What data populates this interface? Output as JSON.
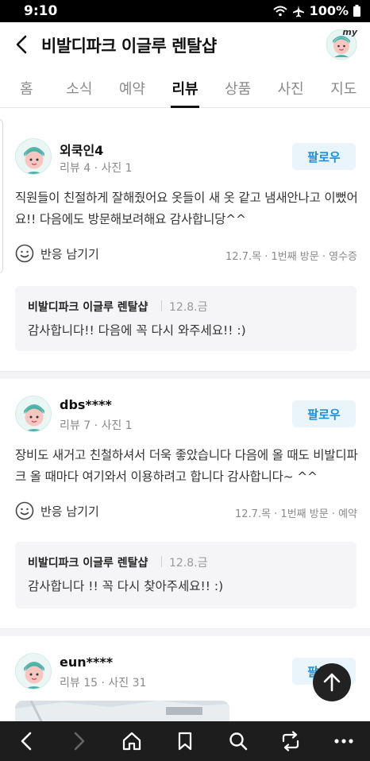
{
  "status": {
    "time": "9:10",
    "battery": "100%"
  },
  "header": {
    "title": "비발디파크 이글루 렌탈샵",
    "my_badge": "my"
  },
  "tabs": [
    {
      "label": "홈",
      "active": false
    },
    {
      "label": "소식",
      "active": false
    },
    {
      "label": "예약",
      "active": false
    },
    {
      "label": "리뷰",
      "active": true
    },
    {
      "label": "상품",
      "active": false
    },
    {
      "label": "사진",
      "active": false
    },
    {
      "label": "지도",
      "active": false
    }
  ],
  "reviews": [
    {
      "user": "외쿡인4",
      "meta": "리뷰 4 · 사진 1",
      "follow": "팔로우",
      "text": "직원들이 친절하게 잘해줬어요 옷들이 새 옷 같고 냄새안나고 이뻤어요!! 다음에도 방문해보려해요 감사합니당^^",
      "react": "반응 남기기",
      "visit": "12.7.목 · 1번째 방문 · 영수증",
      "reply": {
        "owner": "비발디파크 이글루 렌탈샵",
        "date": "12.8.금",
        "text": "감사합니다!! 다음에 꼭 다시 와주세요!! :)"
      }
    },
    {
      "user": "dbs****",
      "meta": "리뷰 7 · 사진 1",
      "follow": "팔로우",
      "text": "장비도 새거고 친철하셔서 더욱 좋았습니다 다음에 올 때도 비발디파크 올 때마다 여기와서 이용하려고 합니다 감사합니다~ ^^",
      "react": "반응 남기기",
      "visit": "12.7.목 · 1번째 방문 · 예약",
      "reply": {
        "owner": "비발디파크 이글루 렌탈샵",
        "date": "12.8.금",
        "text": "감사합니다 !! 꼭 다시 찾아주세요!! :)"
      }
    },
    {
      "user": "eun****",
      "meta": "리뷰 15 · 사진 31",
      "follow": "팔로우"
    }
  ],
  "icons": {
    "back": "back-arrow-icon",
    "smile": "smile-icon",
    "scroll_top": "arrow-up-icon",
    "nav": [
      "back-icon",
      "forward-icon",
      "home-icon",
      "bookmark-icon",
      "search-icon",
      "share-icon",
      "more-icon"
    ]
  },
  "colors": {
    "accent": "#1e8fd8",
    "follow_bg": "#eaf4fb",
    "reply_bg": "#f5f5f7"
  }
}
